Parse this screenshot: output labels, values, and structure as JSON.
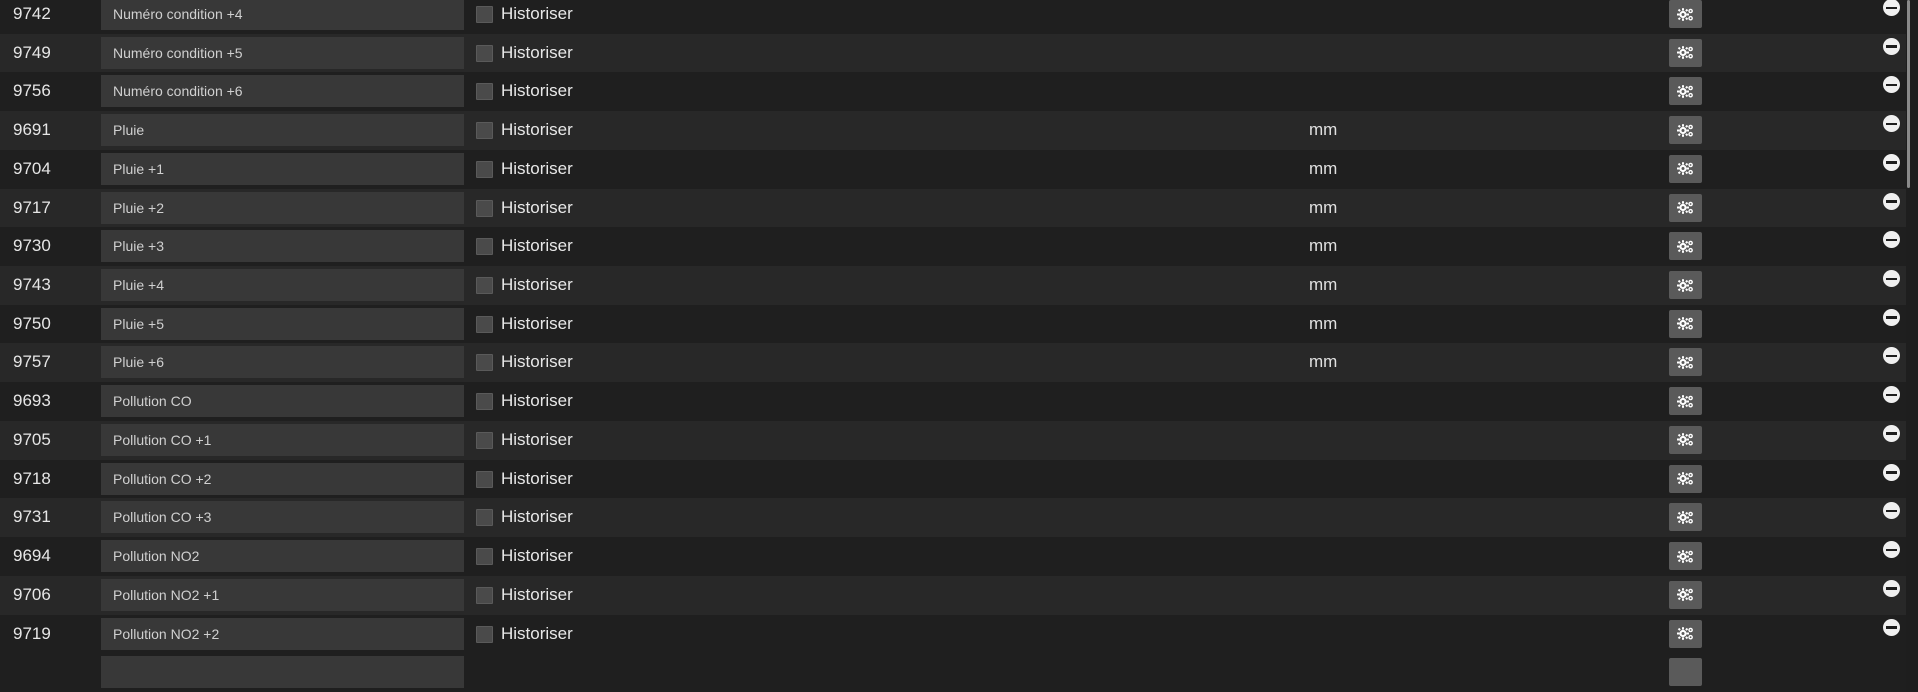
{
  "columns": {
    "historize_label": "Historiser"
  },
  "rows": [
    {
      "id": "9742",
      "name": "Numéro condition +4",
      "unit": ""
    },
    {
      "id": "9749",
      "name": "Numéro condition +5",
      "unit": ""
    },
    {
      "id": "9756",
      "name": "Numéro condition +6",
      "unit": ""
    },
    {
      "id": "9691",
      "name": "Pluie",
      "unit": "mm"
    },
    {
      "id": "9704",
      "name": "Pluie +1",
      "unit": "mm"
    },
    {
      "id": "9717",
      "name": "Pluie +2",
      "unit": "mm"
    },
    {
      "id": "9730",
      "name": "Pluie +3",
      "unit": "mm"
    },
    {
      "id": "9743",
      "name": "Pluie +4",
      "unit": "mm"
    },
    {
      "id": "9750",
      "name": "Pluie +5",
      "unit": "mm"
    },
    {
      "id": "9757",
      "name": "Pluie +6",
      "unit": "mm"
    },
    {
      "id": "9693",
      "name": "Pollution CO",
      "unit": ""
    },
    {
      "id": "9705",
      "name": "Pollution CO +1",
      "unit": ""
    },
    {
      "id": "9718",
      "name": "Pollution CO +2",
      "unit": ""
    },
    {
      "id": "9731",
      "name": "Pollution CO +3",
      "unit": ""
    },
    {
      "id": "9694",
      "name": "Pollution NO2",
      "unit": ""
    },
    {
      "id": "9706",
      "name": "Pollution NO2 +1",
      "unit": ""
    },
    {
      "id": "9719",
      "name": "Pollution NO2 +2",
      "unit": ""
    }
  ],
  "icons": {
    "config": "cogs-icon",
    "remove": "minus-circle-icon",
    "historize": "checkbox-icon"
  },
  "colors": {
    "background": "#1e1e1e",
    "row_alt": "#282828",
    "field_bg": "#383838",
    "button_bg": "#5a5a5a",
    "text": "#e6e6e6"
  }
}
